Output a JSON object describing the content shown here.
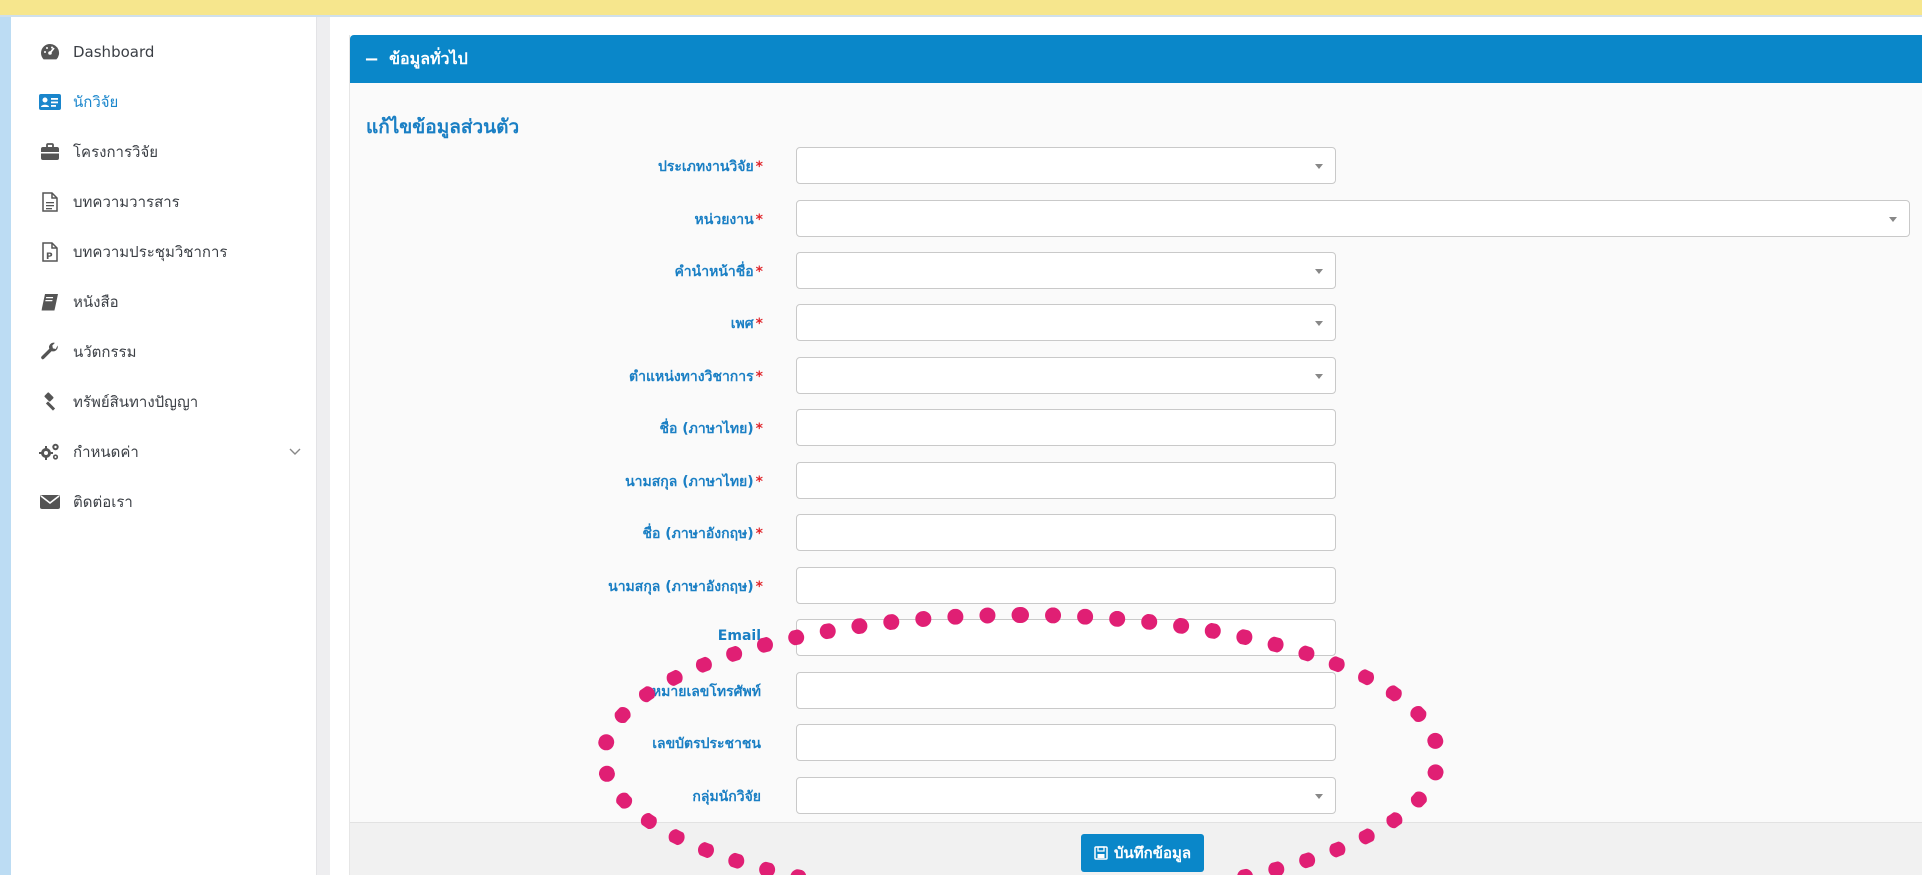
{
  "sidebar": {
    "items": [
      {
        "label": "Dashboard",
        "icon": "dashboard-icon",
        "active": false
      },
      {
        "label": "นักวิจัย",
        "icon": "id-card-icon",
        "active": true
      },
      {
        "label": "โครงการวิจัย",
        "icon": "briefcase-icon",
        "active": false
      },
      {
        "label": "บทความวารสาร",
        "icon": "document-icon",
        "active": false
      },
      {
        "label": "บทความประชุมวิชาการ",
        "icon": "document-p-icon",
        "active": false
      },
      {
        "label": "หนังสือ",
        "icon": "book-icon",
        "active": false
      },
      {
        "label": "นวัตกรรม",
        "icon": "wrench-icon",
        "active": false
      },
      {
        "label": "ทรัพย์สินทางปัญญา",
        "icon": "gavel-icon",
        "active": false
      },
      {
        "label": "กำหนดค่า",
        "icon": "gears-icon",
        "active": false,
        "has_submenu": true
      },
      {
        "label": "ติดต่อเรา",
        "icon": "envelope-icon",
        "active": false
      }
    ]
  },
  "panel": {
    "header": "ข้อมูลทั่วไป",
    "collapse_symbol": "−"
  },
  "form": {
    "title": "แก้ไขข้อมูลส่วนตัว",
    "fields": [
      {
        "label": "ประเภทงานวิจัย",
        "required": "*",
        "type": "select",
        "value": ""
      },
      {
        "label": "หน่วยงาน",
        "required": "*",
        "type": "select",
        "value": ""
      },
      {
        "label": "คำนำหน้าชื่อ",
        "required": "*",
        "type": "select",
        "value": ""
      },
      {
        "label": "เพศ",
        "required": "*",
        "type": "select",
        "value": ""
      },
      {
        "label": "ตำแหน่งทางวิชาการ",
        "required": "*",
        "type": "select",
        "value": ""
      },
      {
        "label": "ชื่อ (ภาษาไทย)",
        "required": "*",
        "type": "text",
        "value": ""
      },
      {
        "label": "นามสกุล (ภาษาไทย)",
        "required": "*",
        "type": "text",
        "value": ""
      },
      {
        "label": "ชื่อ (ภาษาอังกฤษ)",
        "required": "*",
        "type": "text",
        "value": ""
      },
      {
        "label": "นามสกุล (ภาษาอังกฤษ)",
        "required": "*",
        "type": "text",
        "value": ""
      },
      {
        "label": "Email",
        "required": "",
        "type": "text",
        "value": ""
      },
      {
        "label": "หมายเลขโทรศัพท์",
        "required": "",
        "type": "text",
        "value": ""
      },
      {
        "label": "เลขบัตรประชาชน",
        "required": "",
        "type": "text",
        "value": ""
      },
      {
        "label": "กลุ่มนักวิจัย",
        "required": "",
        "type": "select",
        "value": ""
      }
    ],
    "save_label": "บันทึกข้อมูล"
  },
  "colors": {
    "primary": "#0a87c9",
    "label": "#1a7fc4",
    "required": "#e0262c",
    "annotation": "#e01f74",
    "top_band": "#f6e68d"
  }
}
